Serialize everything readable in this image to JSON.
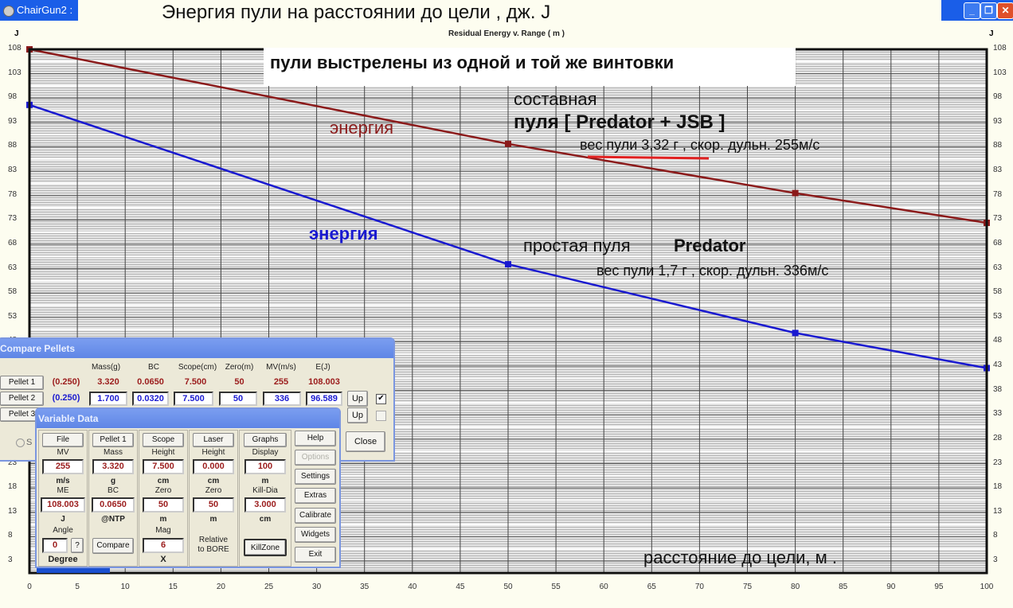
{
  "window": {
    "app_title": "ChairGun2 :",
    "heading": "Энергия  пули  на  расстоянии  до цели ,  дж.  J",
    "buttons": [
      "minimize",
      "restore",
      "close"
    ]
  },
  "chart_data": {
    "type": "line",
    "title": "Residual Energy v. Range ( m )",
    "xlabel": "расстояние до цели, м .",
    "ylabel": "J",
    "xlim": [
      0,
      100
    ],
    "ylim": [
      0,
      108
    ],
    "x_ticks": [
      0,
      5,
      10,
      15,
      20,
      25,
      30,
      35,
      40,
      45,
      50,
      55,
      60,
      65,
      70,
      75,
      80,
      85,
      90,
      95,
      100
    ],
    "y_ticks": [
      108,
      103,
      98,
      93,
      88,
      83,
      78,
      73,
      68,
      63,
      58,
      53,
      48,
      43,
      38,
      33,
      28,
      23,
      18,
      13,
      8,
      3
    ],
    "grid": true,
    "series": [
      {
        "name": "Pellet 1 — составная пуля [Predator + JSB]",
        "color": "#8b1a1a",
        "x": [
          0,
          50,
          80,
          100
        ],
        "y": [
          108.0,
          88.6,
          78.5,
          72.4
        ],
        "markers_at": [
          0,
          50,
          80,
          100
        ]
      },
      {
        "name": "Pellet 2 — простая пуля Predator",
        "color": "#1a1ad0",
        "x": [
          0,
          50,
          80,
          100
        ],
        "y": [
          96.6,
          63.9,
          49.8,
          42.6
        ],
        "markers_at": [
          0,
          50,
          80,
          100
        ]
      }
    ],
    "annotations": {
      "banner": "пули выстрелены из одной и той же винтовки",
      "label_energy_1": "энергия",
      "label_energy_2": "энергия",
      "p1_line1": "составная",
      "p1_line2": "пуля  [ Predator + JSB ]",
      "p1_details": "вес пули 3,32 г ,  скор. дульн. 255м/с",
      "p2_line1_a": "простая пуля",
      "p2_line1_b": "Predator",
      "p2_details": "вес пули 1,7 г , скор. дульн. 336м/с",
      "x_axis_label": "расстояние до цели, м ."
    }
  },
  "compare_pellets": {
    "title": "Compare Pellets",
    "headers": [
      "Mass(g)",
      "BC",
      "Scope(cm)",
      "Zero(m)",
      "MV(m/s)",
      "E(J)"
    ],
    "rows": [
      {
        "button": "Pellet 1",
        "cal": "(0.250)",
        "mass": "3.320",
        "bc": "0.0650",
        "scope": "7.500",
        "zero": "50",
        "mv": "255",
        "e": "108.003"
      },
      {
        "button": "Pellet 2",
        "cal": "(0.250)",
        "mass": "1.700",
        "bc": "0.0320",
        "scope": "7.500",
        "zero": "50",
        "mv": "336",
        "e": "96.589",
        "up": "Up",
        "checked": true
      },
      {
        "button": "Pellet 3",
        "up": "Up",
        "checked": false
      }
    ],
    "radio_label": "S",
    "close": "Close"
  },
  "variable_data": {
    "title": "Variable Data",
    "col1": {
      "button": "File",
      "l1": "MV",
      "v1": "255",
      "u1": "m/s",
      "l2": "ME",
      "v2": "108.003",
      "u2": "J",
      "l3": "Angle",
      "v3": "0",
      "q": "?",
      "u3": "Degree"
    },
    "col2": {
      "button": "Pellet 1",
      "l1": "Mass",
      "v1": "3.320",
      "u1": "g",
      "l2": "BC",
      "v2": "0.0650",
      "u2": "@NTP",
      "btn2": "Compare"
    },
    "col3": {
      "button": "Scope",
      "l1": "Height",
      "v1": "7.500",
      "u1": "cm",
      "l2": "Zero",
      "v2": "50",
      "u2": "m",
      "l3": "Mag",
      "v3": "6",
      "u3": "X"
    },
    "col4": {
      "button": "Laser",
      "l1": "Height",
      "v1": "0.000",
      "u1": "cm",
      "l2": "Zero",
      "v2": "50",
      "u2": "m",
      "l3": "Relative",
      "l4": "to BORE"
    },
    "col5": {
      "button": "Graphs",
      "l1": "Display",
      "v1": "100",
      "u1": "m",
      "l2": "Kill-Dia",
      "v2": "3.000",
      "u2": "cm",
      "btn2": "KillZone"
    },
    "side": [
      "Help",
      "Options",
      "Settings",
      "Extras",
      "Calibrate",
      "Widgets",
      "Exit"
    ]
  }
}
